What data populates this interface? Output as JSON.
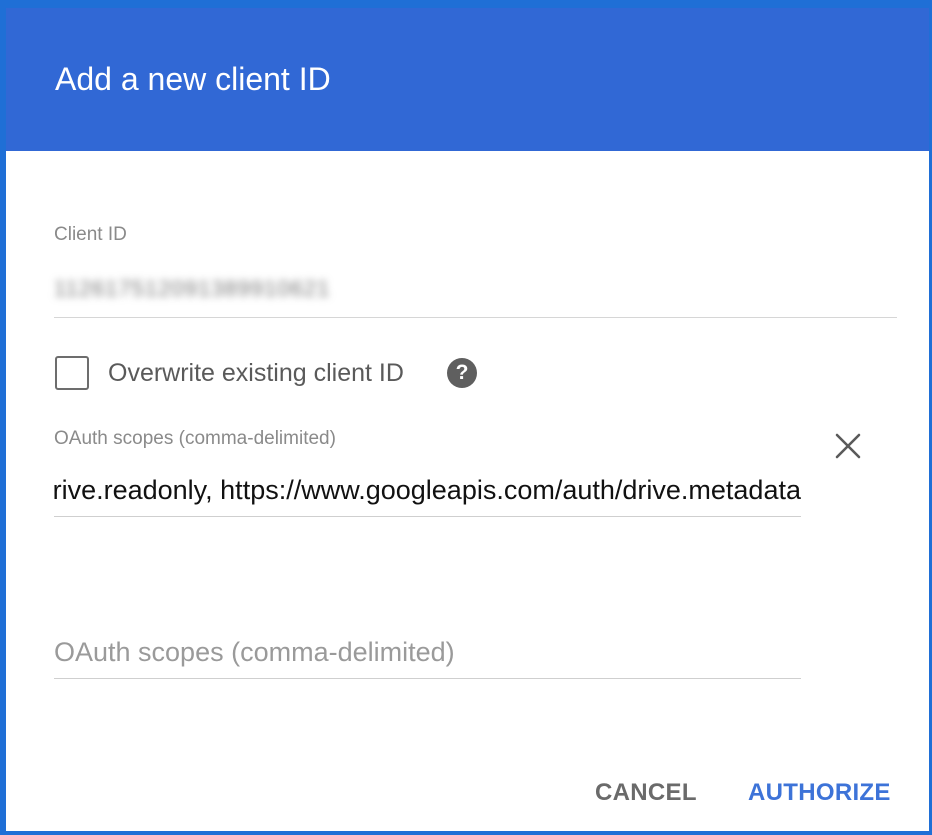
{
  "dialog": {
    "title": "Add a new client ID"
  },
  "client_id": {
    "label": "Client ID",
    "value": "112617512091389910621"
  },
  "overwrite": {
    "label": "Overwrite existing client ID",
    "checked": false,
    "help_icon": "help-icon"
  },
  "scopes": {
    "label": "OAuth scopes (comma-delimited)",
    "value": "https://www.googleapis.com/auth/drive.readonly, https://www.googleapis.com/auth/drive.metadata",
    "placeholder": "OAuth scopes (comma-delimited)",
    "remove_icon": "close-icon"
  },
  "actions": {
    "cancel_label": "CANCEL",
    "authorize_label": "AUTHORIZE"
  },
  "colors": {
    "header": "#3168d5",
    "frame": "#1f6fd6",
    "primary_button": "#3d73d8"
  }
}
